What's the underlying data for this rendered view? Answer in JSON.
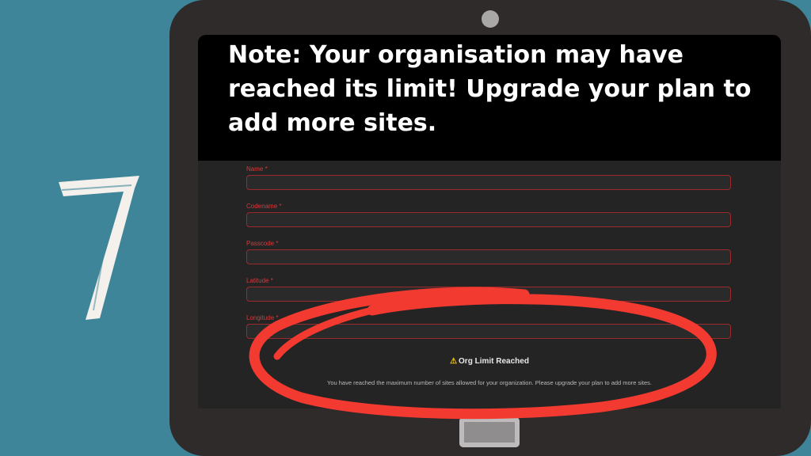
{
  "step": {
    "number": "7"
  },
  "note": {
    "text": "Note: Your organisation may have reached its limit! Upgrade your plan to add more sites."
  },
  "form": {
    "fields": [
      {
        "label": "Name *",
        "value": ""
      },
      {
        "label": "Codename *",
        "value": ""
      },
      {
        "label": "Passcode *",
        "value": ""
      },
      {
        "label": "Latitude *",
        "value": ""
      },
      {
        "label": "Longitude *",
        "value": ""
      }
    ]
  },
  "alert": {
    "icon": "warning-icon",
    "icon_glyph": "⚠",
    "title": "Org Limit Reached",
    "message": "You have reached the maximum number of sites allowed for your organization. Please upgrade your plan to add more sites."
  },
  "colors": {
    "background": "#3f8599",
    "tablet": "#2f2b2b",
    "annotation_red": "#f23a30",
    "label_red": "#d9383a",
    "warning_yellow": "#f2c41b"
  }
}
